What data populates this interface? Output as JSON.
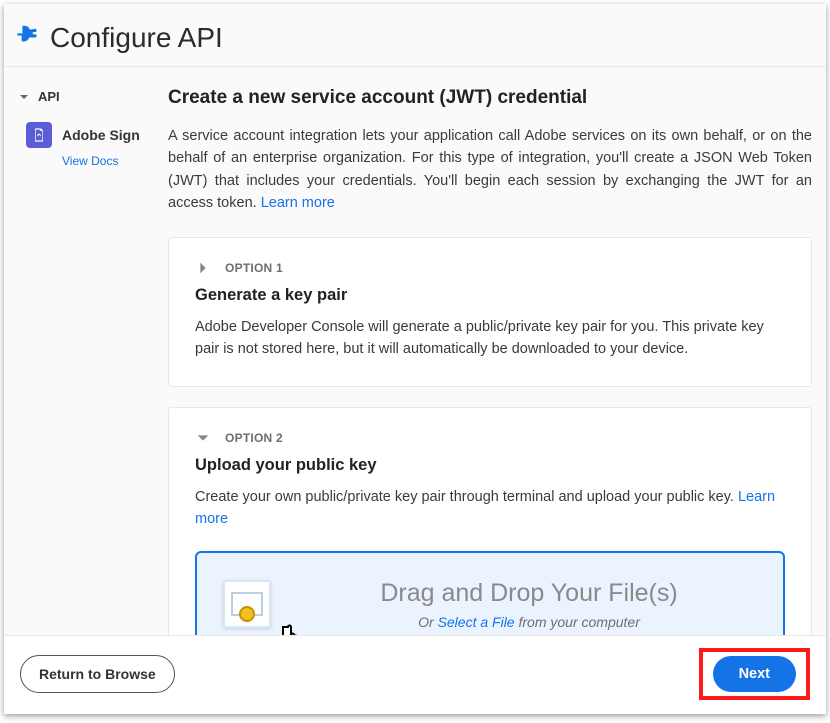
{
  "header": {
    "title": "Configure API"
  },
  "sidebar": {
    "group_label": "API",
    "items": [
      {
        "name": "Adobe Sign",
        "view_docs_label": "View Docs"
      }
    ]
  },
  "main": {
    "title": "Create a new service account (JWT) credential",
    "description": "A service account integration lets your application call Adobe services on its own behalf, or on the behalf of an enterprise organization. For this type of integration, you'll create a JSON Web Token (JWT) that includes your credentials. You'll begin each session by exchanging the JWT for an access token. ",
    "learn_more": "Learn more",
    "options": [
      {
        "label": "OPTION 1",
        "title": "Generate a key pair",
        "description": "Adobe Developer Console will generate a public/private key pair for you. This private key pair is not stored here, but it will automatically be downloaded to your device.",
        "expanded": false
      },
      {
        "label": "OPTION 2",
        "title": "Upload your public key",
        "description": "Create your own public/private key pair through terminal and upload your public key. ",
        "learn_more": "Learn more",
        "expanded": true
      }
    ],
    "dropzone": {
      "main_text": "Drag and Drop Your File(s)",
      "sub_prefix": "Or ",
      "select_label": "Select a File",
      "sub_suffix": " from your computer"
    }
  },
  "footer": {
    "return_label": "Return to Browse",
    "next_label": "Next"
  }
}
